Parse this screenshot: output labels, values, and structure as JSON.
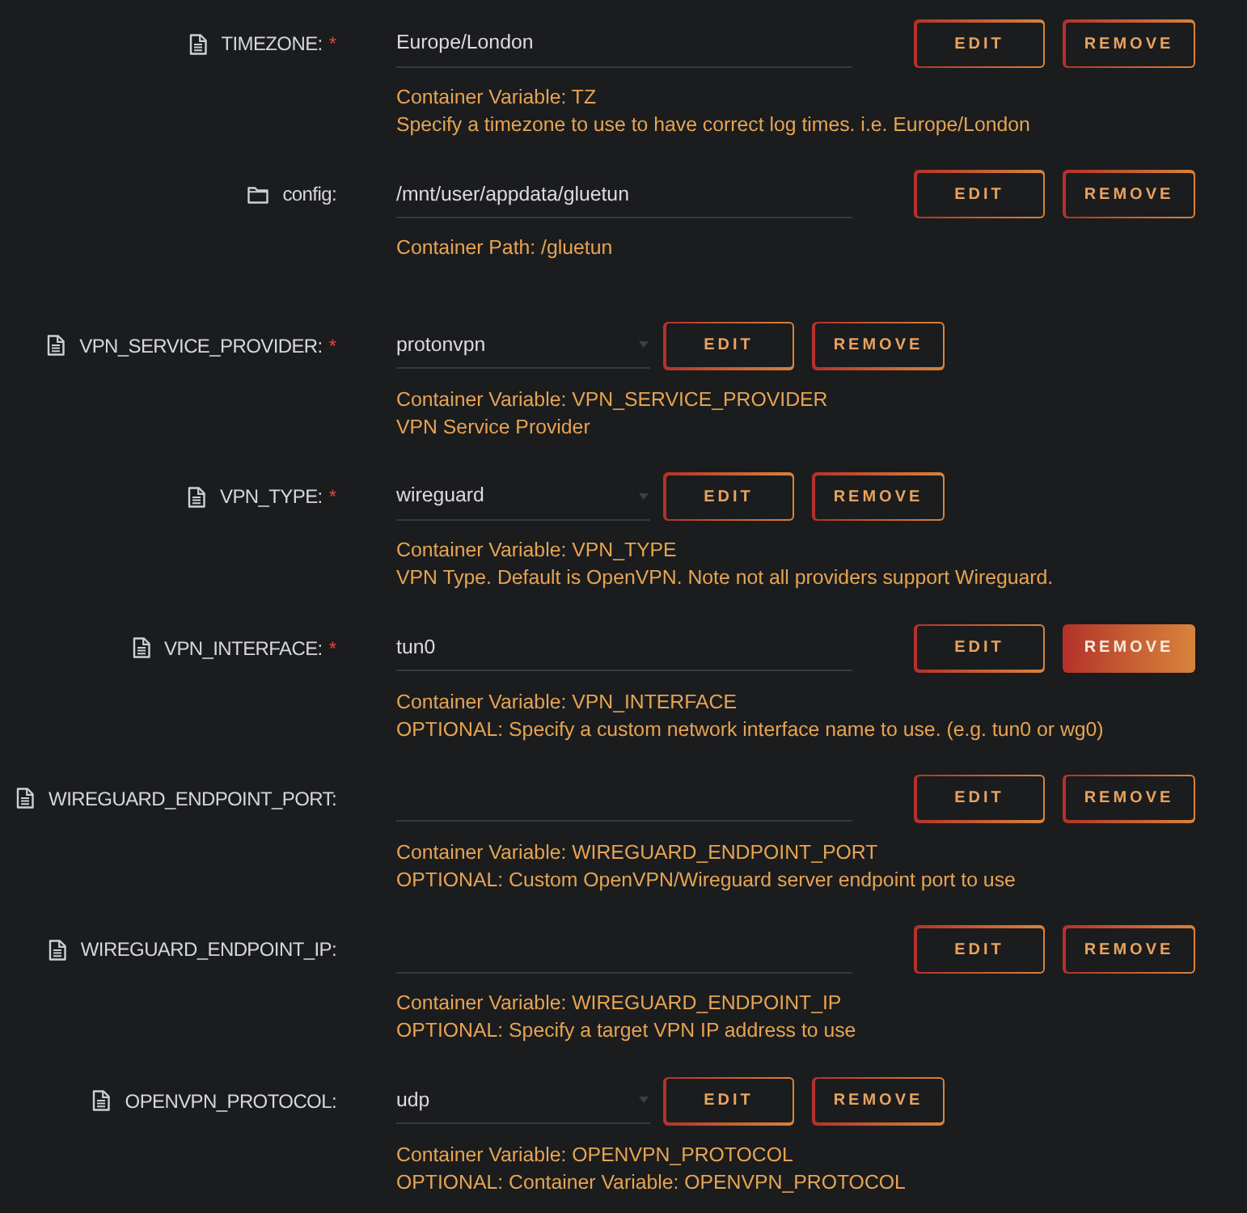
{
  "rows": [
    {
      "kind": "variable",
      "label": "TIMEZONE:",
      "required_mark": "*",
      "field": {
        "kind": "text",
        "value": "Europe/London"
      },
      "buttons": [
        {
          "label": "EDIT",
          "active": false
        },
        {
          "label": "REMOVE",
          "active": false
        }
      ],
      "description": [
        "Container Variable: TZ",
        "Specify a timezone to use to have correct log times. i.e. Europe/London"
      ]
    },
    {
      "kind": "path",
      "label": "config:",
      "field": {
        "kind": "text",
        "value": "/mnt/user/appdata/gluetun"
      },
      "buttons": [
        {
          "label": "EDIT",
          "active": false
        },
        {
          "label": "REMOVE",
          "active": false
        }
      ],
      "description": [
        "Container Path: /gluetun"
      ]
    },
    {
      "kind": "variable",
      "label": "VPN_SERVICE_PROVIDER:",
      "required_mark": "*",
      "field": {
        "kind": "select",
        "value": "protonvpn"
      },
      "buttons": [
        {
          "label": "EDIT",
          "active": false
        },
        {
          "label": "REMOVE",
          "active": false
        }
      ],
      "description": [
        "Container Variable: VPN_SERVICE_PROVIDER",
        "VPN Service Provider"
      ]
    },
    {
      "kind": "variable",
      "label": "VPN_TYPE:",
      "required_mark": "*",
      "field": {
        "kind": "select",
        "value": "wireguard"
      },
      "buttons": [
        {
          "label": "EDIT",
          "active": false
        },
        {
          "label": "REMOVE",
          "active": false
        }
      ],
      "description": [
        "Container Variable: VPN_TYPE",
        "VPN Type. Default is OpenVPN. Note not all providers support Wireguard."
      ]
    },
    {
      "kind": "variable",
      "label": "VPN_INTERFACE:",
      "required_mark": "*",
      "field": {
        "kind": "text",
        "value": "tun0"
      },
      "buttons": [
        {
          "label": "EDIT",
          "active": false
        },
        {
          "label": "REMOVE",
          "active": true
        }
      ],
      "description": [
        "Container Variable: VPN_INTERFACE",
        "OPTIONAL: Specify a custom network interface name to use. (e.g. tun0 or wg0)"
      ]
    },
    {
      "kind": "variable",
      "label": "WIREGUARD_ENDPOINT_PORT:",
      "field": {
        "kind": "text"
      },
      "buttons": [
        {
          "label": "EDIT",
          "active": false
        },
        {
          "label": "REMOVE",
          "active": false
        }
      ],
      "description": [
        "Container Variable: WIREGUARD_ENDPOINT_PORT",
        "OPTIONAL: Custom OpenVPN/Wireguard server endpoint port to use"
      ]
    },
    {
      "kind": "variable",
      "label": "WIREGUARD_ENDPOINT_IP:",
      "field": {
        "kind": "text"
      },
      "buttons": [
        {
          "label": "EDIT",
          "active": false
        },
        {
          "label": "REMOVE",
          "active": false
        }
      ],
      "description": [
        "Container Variable: WIREGUARD_ENDPOINT_IP",
        "OPTIONAL: Specify a target VPN IP address to use"
      ]
    },
    {
      "kind": "variable",
      "label": "OPENVPN_PROTOCOL:",
      "field": {
        "kind": "select",
        "value": "udp"
      },
      "buttons": [
        {
          "label": "EDIT",
          "active": false
        },
        {
          "label": "REMOVE",
          "active": false
        }
      ],
      "description": [
        "Container Variable: OPENVPN_PROTOCOL",
        "OPTIONAL: Container Variable: OPENVPN_PROTOCOL"
      ]
    }
  ]
}
